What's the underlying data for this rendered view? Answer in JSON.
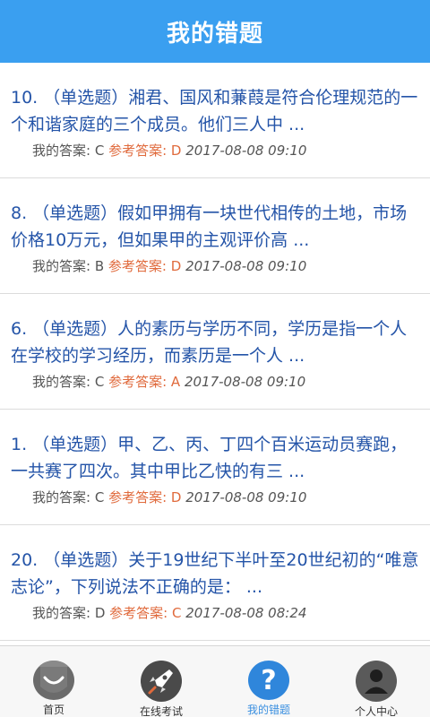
{
  "header": {
    "title": "我的错题"
  },
  "items": [
    {
      "question": "10. （单选题）湘君、国风和蒹葭是符合伦理规范的一个和谐家庭的三个成员。他们三人中 ...",
      "my_answer_label": "我的答案: C",
      "ref_answer_label": "参考答案: D",
      "datetime": "2017-08-08 09:10"
    },
    {
      "question": "8. （单选题）假如甲拥有一块世代相传的土地，市场价格10万元，但如果甲的主观评价高 ...",
      "my_answer_label": "我的答案: B",
      "ref_answer_label": "参考答案: D",
      "datetime": "2017-08-08 09:10"
    },
    {
      "question": "6. （单选题）人的素历与学历不同，学历是指一个人在学校的学习经历，而素历是一个人 ...",
      "my_answer_label": "我的答案: C",
      "ref_answer_label": "参考答案: A",
      "datetime": "2017-08-08 09:10"
    },
    {
      "question": "1. （单选题）甲、乙、丙、丁四个百米运动员赛跑，一共赛了四次。其中甲比乙快的有三 ...",
      "my_answer_label": "我的答案: C",
      "ref_answer_label": "参考答案: D",
      "datetime": "2017-08-08 09:10"
    },
    {
      "question": "20. （单选题）关于19世纪下半叶至20世纪初的“唯意志论”，下列说法不正确的是： ...",
      "my_answer_label": "我的答案: D",
      "ref_answer_label": "参考答案: C",
      "datetime": "2017-08-08 08:24"
    }
  ],
  "tabbar": {
    "tabs": [
      {
        "label": "首页",
        "icon": "home-icon"
      },
      {
        "label": "在线考试",
        "icon": "rocket-icon"
      },
      {
        "label": "我的错题",
        "icon": "question-icon",
        "glyph": "?"
      },
      {
        "label": "个人中心",
        "icon": "user-icon"
      }
    ],
    "active_index": 2
  },
  "colors": {
    "header_bg": "#3a9ff0",
    "question_text": "#2454a8",
    "reference_answer": "#e06a3c",
    "active_tab": "#3a8fe0"
  }
}
